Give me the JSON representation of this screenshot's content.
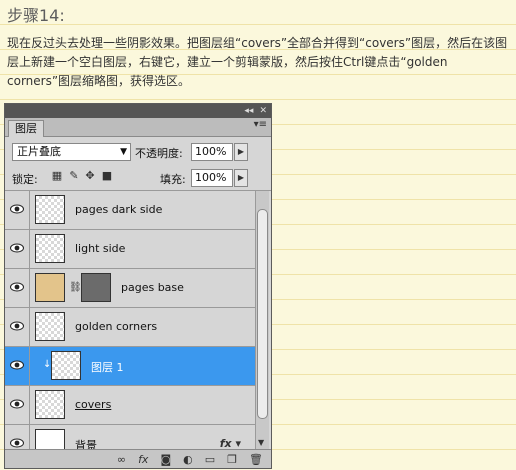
{
  "article": {
    "step_title": "步骤14:",
    "paragraph": "现在反过头去处理一些阴影效果。把图层组“covers”全部合并得到“covers”图层，然后在该图层上新建一个空白图层，右键它，建立一个剪辑蒙版，然后按住Ctrl键点击“golden corners”图层缩略图，获得选区。"
  },
  "panel": {
    "tab_label": "图层",
    "blend_mode": "正片叠底",
    "opacity_label": "不透明度:",
    "opacity_value": "100%",
    "lock_label": "锁定:",
    "fill_label": "填充:",
    "fill_value": "100%",
    "layers": [
      {
        "name": "pages dark side",
        "visible": true
      },
      {
        "name": "light side",
        "visible": true
      },
      {
        "name": "pages base",
        "visible": true,
        "has_mask": true
      },
      {
        "name": "golden corners",
        "visible": true
      },
      {
        "name": "图层 1",
        "visible": true,
        "selected": true,
        "clipped": true
      },
      {
        "name": "covers",
        "visible": true
      },
      {
        "name": "背景",
        "visible": true,
        "has_fx": true
      }
    ],
    "icons": [
      "link-icon",
      "fx-icon",
      "mask-icon",
      "adjustment-icon",
      "group-icon",
      "new-layer-icon",
      "trash-icon"
    ],
    "accent_color": "#3b98ee"
  }
}
